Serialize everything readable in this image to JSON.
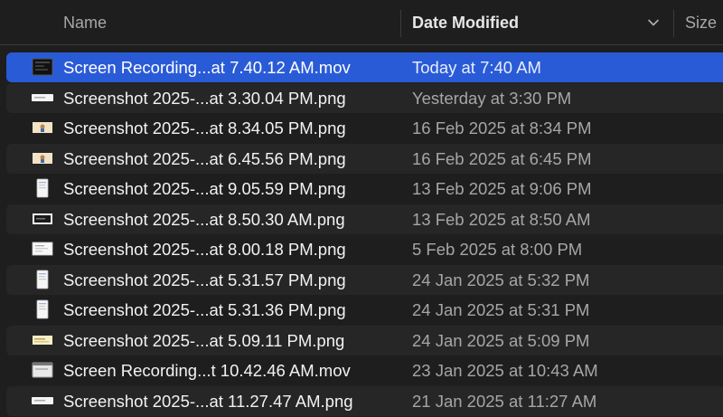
{
  "header": {
    "name_label": "Name",
    "date_label": "Date Modified",
    "size_label": "Size"
  },
  "files": [
    {
      "name": "Screen Recording...at 7.40.12 AM.mov",
      "date": "Today at 7:40 AM",
      "thumb": "recording-dark",
      "selected": true
    },
    {
      "name": "Screenshot 2025-...at 3.30.04 PM.png",
      "date": "Yesterday at 3:30 PM",
      "thumb": "wide-white"
    },
    {
      "name": "Screenshot 2025-...at 8.34.05 PM.png",
      "date": "16 Feb 2025 at 8:34 PM",
      "thumb": "landscape-photo"
    },
    {
      "name": "Screenshot 2025-...at 6.45.56 PM.png",
      "date": "16 Feb 2025 at 6:45 PM",
      "thumb": "landscape-photo"
    },
    {
      "name": "Screenshot 2025-...at 9.05.59 PM.png",
      "date": "13 Feb 2025 at 9:06 PM",
      "thumb": "portrait-white"
    },
    {
      "name": "Screenshot 2025-...at 8.50.30 AM.png",
      "date": "13 Feb 2025 at 8:50 AM",
      "thumb": "landscape-dark"
    },
    {
      "name": "Screenshot 2025-...at 8.00.18 PM.png",
      "date": "5 Feb 2025 at 8:00 PM",
      "thumb": "landscape-white"
    },
    {
      "name": "Screenshot 2025-...at 5.31.57 PM.png",
      "date": "24 Jan 2025 at 5:32 PM",
      "thumb": "portrait-white"
    },
    {
      "name": "Screenshot 2025-...at 5.31.36 PM.png",
      "date": "24 Jan 2025 at 5:31 PM",
      "thumb": "portrait-white"
    },
    {
      "name": "Screenshot 2025-...at 5.09.11 PM.png",
      "date": "24 Jan 2025 at 5:09 PM",
      "thumb": "landscape-yellow"
    },
    {
      "name": "Screen Recording...t 10.42.46 AM.mov",
      "date": "23 Jan 2025 at 10:43 AM",
      "thumb": "recording-light"
    },
    {
      "name": "Screenshot 2025-...at 11.27.47 AM.png",
      "date": "21 Jan 2025 at 11:27 AM",
      "thumb": "wide-white"
    }
  ],
  "colors": {
    "selection": "#2a5bd7",
    "background": "#1e1e1e",
    "alt_row": "#262626"
  }
}
